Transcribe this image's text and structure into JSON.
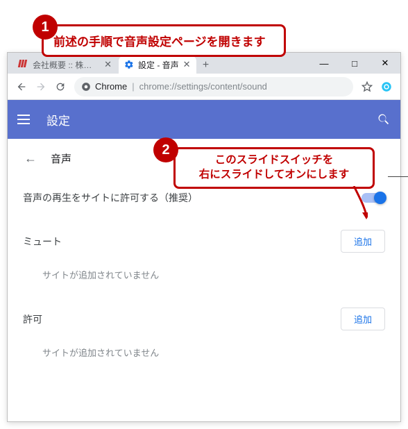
{
  "callouts": {
    "one": {
      "num": "1",
      "text": "前述の手順で音声設定ページを開きます"
    },
    "two": {
      "num": "2",
      "line1": "このスライドスイッチを",
      "line2": "右にスライドしてオンにします"
    }
  },
  "window": {
    "minimize": "—",
    "maximize": "□",
    "close": "✕"
  },
  "tabs": {
    "inactive": {
      "title": "会社概要 :: 株式会社…",
      "close": "✕"
    },
    "active": {
      "title": "設定 - 音声",
      "close": "✕"
    },
    "newtab": "+"
  },
  "addressbar": {
    "host": "Chrome",
    "path": "chrome://settings/content/sound"
  },
  "header": {
    "title": "設定"
  },
  "content": {
    "section_title": "音声",
    "allow_label": "音声の再生をサイトに許可する（推奨）",
    "mute": {
      "title": "ミュート",
      "add": "追加",
      "empty": "サイトが追加されていません"
    },
    "allow": {
      "title": "許可",
      "add": "追加",
      "empty": "サイトが追加されていません"
    }
  }
}
